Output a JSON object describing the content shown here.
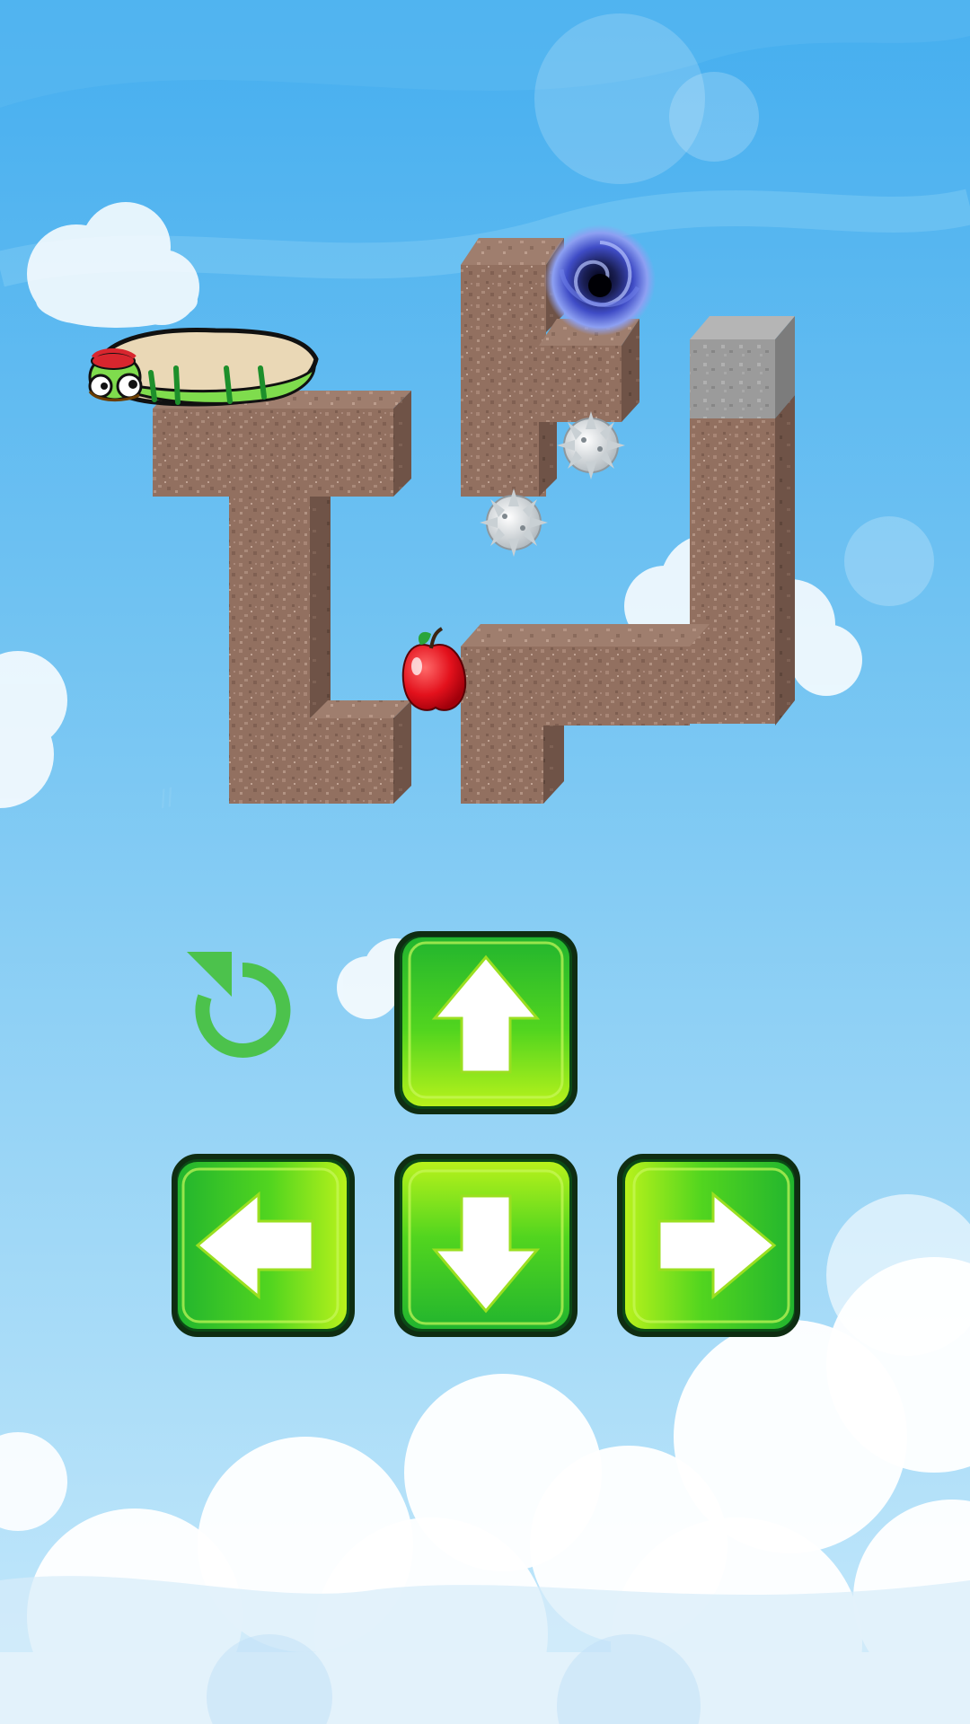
{
  "game": {
    "title": "",
    "colors": {
      "sky_top": "#3aa6ea",
      "sky_bottom": "#bfe6fb",
      "dirt": "#93705f",
      "dirt_top": "#a07d6d",
      "dirt_side": "#6d5146",
      "stone": "#9c9c9c",
      "button_green": "#2fcf2f",
      "button_light": "#b6f51e",
      "restart_green": "#4cc24c"
    },
    "entities": {
      "worm": "caterpillar-player",
      "apple": "red-apple",
      "portal": "black-hole-portal",
      "spikes": [
        "spiked-ball",
        "spiked-ball"
      ]
    },
    "controls": {
      "restart": "restart-icon",
      "up": "arrow-up-icon",
      "left": "arrow-left-icon",
      "down": "arrow-down-icon",
      "right": "arrow-right-icon"
    }
  }
}
